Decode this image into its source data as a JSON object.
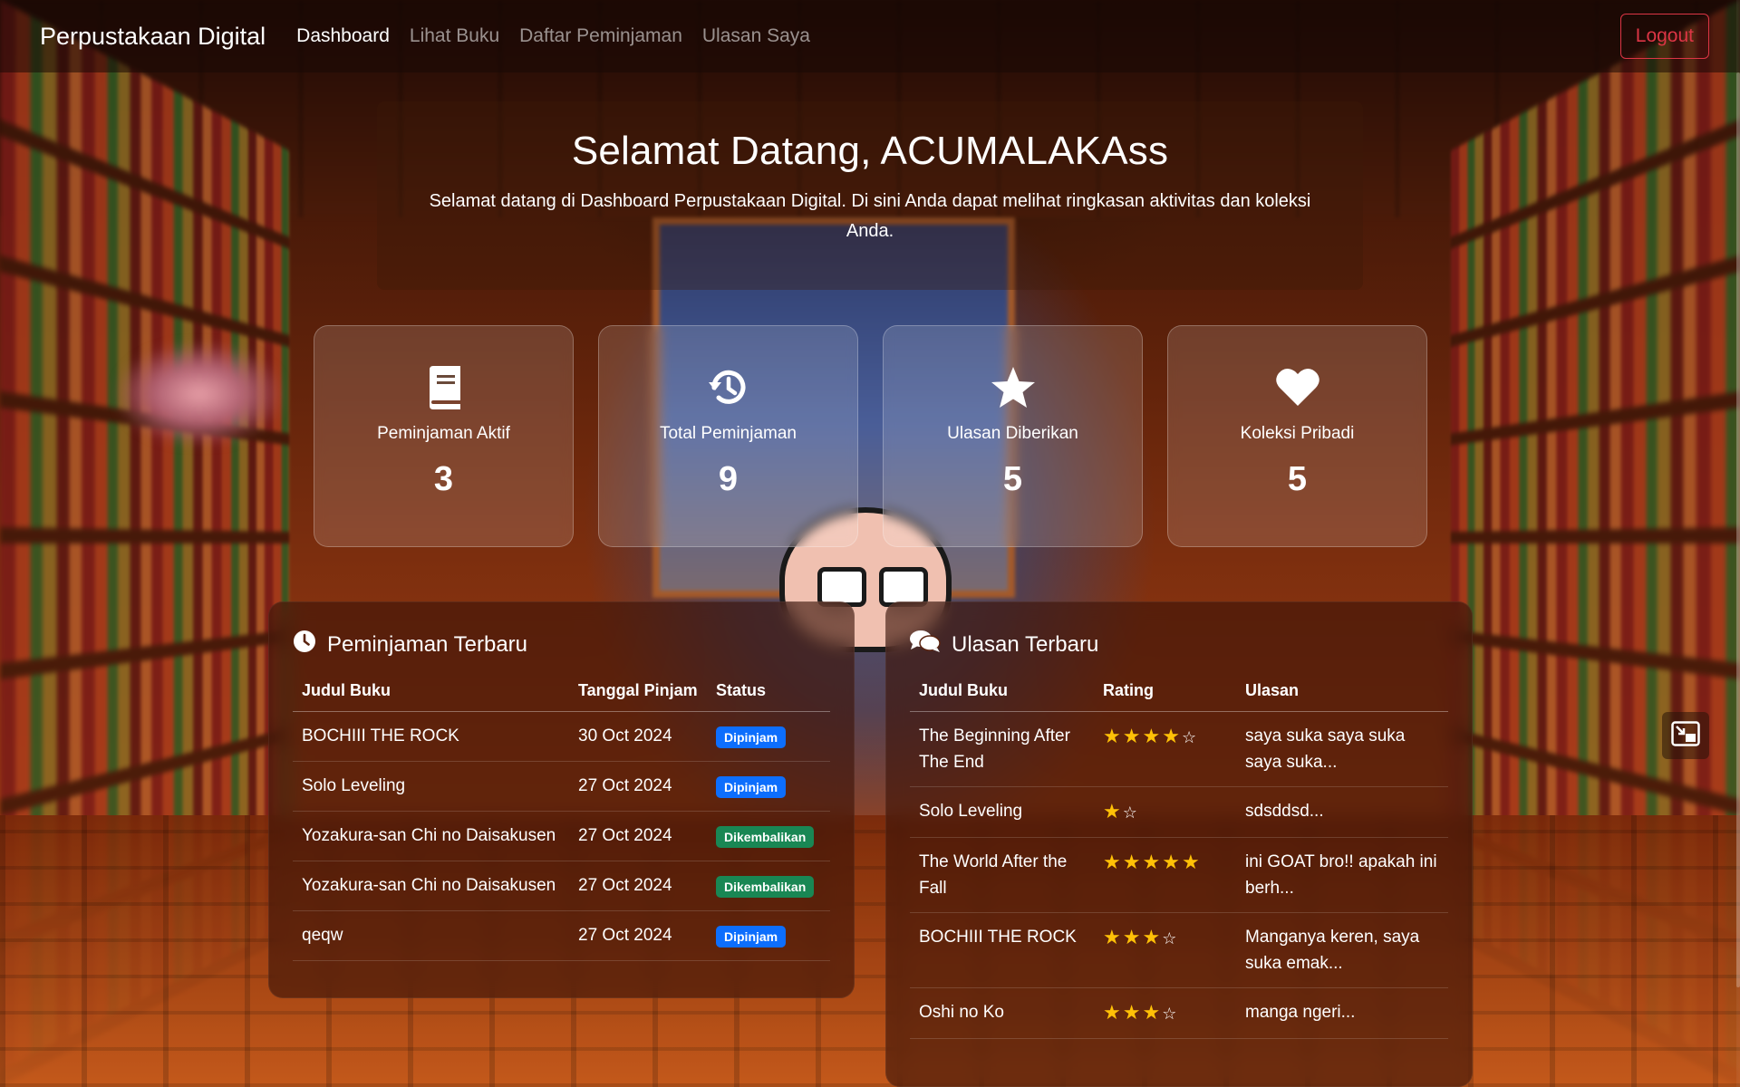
{
  "navbar": {
    "brand": "Perpustakaan Digital",
    "links": [
      "Dashboard",
      "Lihat Buku",
      "Daftar Peminjaman",
      "Ulasan Saya"
    ],
    "active_link": "Dashboard",
    "logout_label": "Logout"
  },
  "hero": {
    "title": "Selamat Datang, ACUMALAKAss",
    "subtitle": "Selamat datang di Dashboard Perpustakaan Digital. Di sini Anda dapat melihat ringkasan aktivitas dan koleksi Anda."
  },
  "stats": [
    {
      "icon": "book-icon",
      "label": "Peminjaman Aktif",
      "value": "3"
    },
    {
      "icon": "history-icon",
      "label": "Total Peminjaman",
      "value": "9"
    },
    {
      "icon": "star-icon",
      "label": "Ulasan Diberikan",
      "value": "5"
    },
    {
      "icon": "heart-icon",
      "label": "Koleksi Pribadi",
      "value": "5"
    }
  ],
  "recent_loans": {
    "title": "Peminjaman Terbaru",
    "icon": "clock-icon",
    "headers": [
      "Judul Buku",
      "Tanggal Pinjam",
      "Status"
    ],
    "rows": [
      {
        "title": "BOCHIII THE ROCK",
        "date": "30 Oct 2024",
        "status": "Dipinjam"
      },
      {
        "title": "Solo Leveling",
        "date": "27 Oct 2024",
        "status": "Dipinjam"
      },
      {
        "title": "Yozakura-san Chi no Daisakusen",
        "date": "27 Oct 2024",
        "status": "Dikembalikan"
      },
      {
        "title": "Yozakura-san Chi no Daisakusen",
        "date": "27 Oct 2024",
        "status": "Dikembalikan"
      },
      {
        "title": "qeqw",
        "date": "27 Oct 2024",
        "status": "Dipinjam"
      }
    ]
  },
  "recent_reviews": {
    "title": "Ulasan Terbaru",
    "icon": "comments-icon",
    "headers": [
      "Judul Buku",
      "Rating",
      "Ulasan"
    ],
    "rows": [
      {
        "title": "The Beginning After The End",
        "rating": 4,
        "review": "saya suka saya suka saya suka..."
      },
      {
        "title": "Solo Leveling",
        "rating": 1,
        "review": "sdsddsd..."
      },
      {
        "title": "The World After the Fall",
        "rating": 5,
        "review": "ini GOAT bro!! apakah ini berh..."
      },
      {
        "title": "BOCHIII THE ROCK",
        "rating": 3,
        "review": "Manganya keren, saya suka emak..."
      },
      {
        "title": "Oshi no Ko",
        "rating": 3,
        "review": "manga ngeri..."
      }
    ]
  },
  "colors": {
    "status_dipinjam": "#0d6efd",
    "status_dikembalikan": "#198754",
    "logout": "#dc3545",
    "star": "#ffc107"
  }
}
